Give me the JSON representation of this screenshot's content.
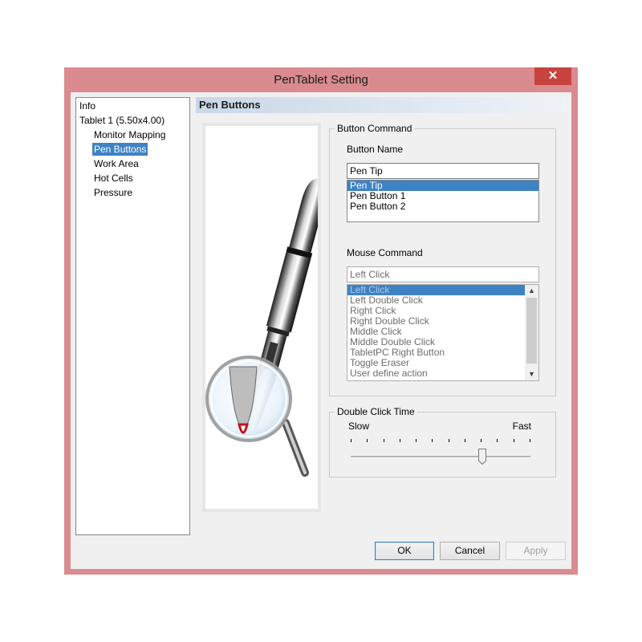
{
  "window": {
    "title": "PenTablet Setting",
    "close_glyph": "✕"
  },
  "tree": {
    "items": [
      {
        "label": "Info",
        "selected": false
      },
      {
        "label": "Tablet  1 (5.50x4.00)",
        "selected": false
      },
      {
        "label": "Monitor Mapping",
        "selected": false
      },
      {
        "label": "Pen Buttons",
        "selected": true
      },
      {
        "label": "Work Area",
        "selected": false
      },
      {
        "label": "Hot Cells",
        "selected": false
      },
      {
        "label": "Pressure",
        "selected": false
      }
    ]
  },
  "panel": {
    "title": "Pen Buttons"
  },
  "button_command": {
    "group_title": "Button Command",
    "button_name_label": "Button Name",
    "button_name_value": "Pen Tip",
    "button_list": [
      "Pen Tip",
      "Pen Button 1",
      "Pen Button 2"
    ],
    "mouse_command_label": "Mouse Command",
    "mouse_command_value": "Left Click",
    "mouse_list": [
      "Left Click",
      "Left Double Click",
      "Right Click",
      "Right Double Click",
      "Middle Click",
      "Middle Double Click",
      "TabletPC Right Button",
      "Toggle Eraser",
      "User define action"
    ]
  },
  "double_click": {
    "group_title": "Double Click Time",
    "slow_label": "Slow",
    "fast_label": "Fast",
    "tick_count": 12,
    "value_fraction": 0.73
  },
  "buttons": {
    "ok": "OK",
    "cancel": "Cancel",
    "apply": "Apply"
  },
  "colors": {
    "title_bar": "#d98b8f",
    "close": "#c7433d",
    "selection": "#3f82c4"
  },
  "icons": {
    "close": "close-icon",
    "scroll_up": "chevron-up-icon",
    "scroll_down": "chevron-down-icon"
  }
}
